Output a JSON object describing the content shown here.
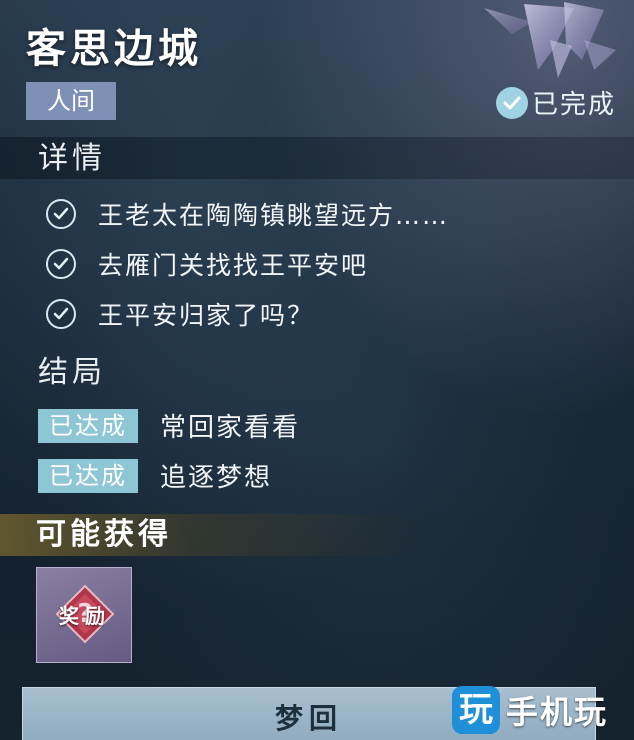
{
  "header": {
    "title": "客思边城",
    "realm_tag": "人间",
    "status": "已完成",
    "status_icon": "check-badge-icon"
  },
  "details": {
    "heading": "详情",
    "items": [
      {
        "text": "王老太在陶陶镇眺望远方……",
        "done": true
      },
      {
        "text": "去雁门关找找王平安吧",
        "done": true
      },
      {
        "text": "王平安归家了吗？",
        "done": true
      }
    ]
  },
  "endings": {
    "heading": "结局",
    "items": [
      {
        "tag": "已达成",
        "text": "常回家看看"
      },
      {
        "tag": "已达成",
        "text": "追逐梦想"
      }
    ]
  },
  "rewards": {
    "heading": "可能获得",
    "item_label": "奖励",
    "item_icon": "mystery-reward-icon"
  },
  "action": {
    "dream_button": "梦回"
  },
  "watermark": {
    "logo_char": "玩",
    "text": "手机玩"
  },
  "colors": {
    "accent": "#8fc6d6",
    "realm_tag": "#7f90b6",
    "reward_frame": "#7a6f96"
  }
}
